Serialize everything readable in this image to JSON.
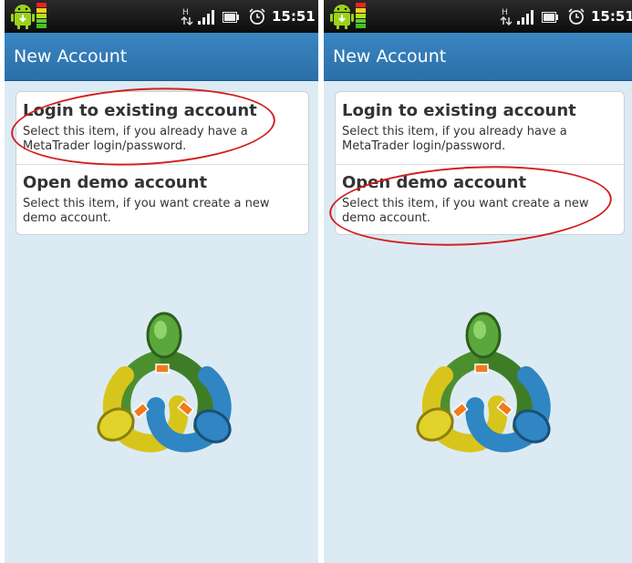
{
  "screens": [
    {
      "statusbar": {
        "time": "15:51",
        "network": "H"
      },
      "appbar": {
        "title": "New Account"
      },
      "items": [
        {
          "title": "Login to existing account",
          "description": "Select this item, if you already have a MetaTrader login/password."
        },
        {
          "title": "Open demo account",
          "description": "Select this item, if you want create a new demo account."
        }
      ],
      "highlighted_item": 0
    },
    {
      "statusbar": {
        "time": "15:51",
        "network": "H"
      },
      "appbar": {
        "title": "New Account"
      },
      "items": [
        {
          "title": "Login to existing account",
          "description": "Select this item, if you already have a MetaTrader login/password."
        },
        {
          "title": "Open demo account",
          "description": "Select this item, if you want create a new demo account."
        }
      ],
      "highlighted_item": 1
    }
  ],
  "icons": {
    "status": [
      "android-icon",
      "level-meter-icon",
      "hplus-icon",
      "signal-icon",
      "battery-icon",
      "alarm-icon"
    ],
    "logo": "metatrader-logo"
  },
  "colors": {
    "appbar": "#2f7ab8",
    "background": "#dcebf3",
    "highlight": "#d41f1f",
    "logo_green": "#4c8f2f",
    "logo_yellow": "#d8c51c",
    "logo_blue": "#2f86c2"
  }
}
